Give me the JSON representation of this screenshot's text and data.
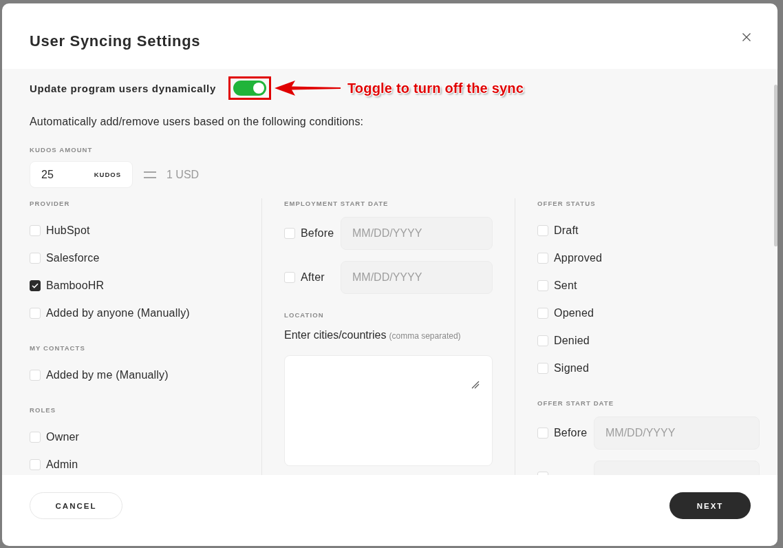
{
  "dialog": {
    "title": "User Syncing Settings"
  },
  "sync_toggle": {
    "label": "Update program users dynamically",
    "on": true
  },
  "annotation": {
    "text": "Toggle to turn off the sync"
  },
  "intro": "Automatically add/remove users based on the following conditions:",
  "kudos_amount": {
    "label": "KUDOS AMOUNT",
    "value": "25",
    "unit": "KUDOS",
    "equals": "1 USD"
  },
  "columns": [
    {
      "sections": [
        {
          "kind": "checklist",
          "label": "PROVIDER",
          "items": [
            {
              "label": "HubSpot",
              "checked": false
            },
            {
              "label": "Salesforce",
              "checked": false
            },
            {
              "label": "BambooHR",
              "checked": true
            },
            {
              "label": "Added by anyone (Manually)",
              "checked": false
            }
          ]
        },
        {
          "kind": "checklist",
          "label": "MY CONTACTS",
          "items": [
            {
              "label": "Added by me (Manually)",
              "checked": false
            }
          ]
        },
        {
          "kind": "checklist",
          "label": "ROLES",
          "items": [
            {
              "label": "Owner",
              "checked": false
            },
            {
              "label": "Admin",
              "checked": false
            }
          ]
        }
      ]
    },
    {
      "sections": [
        {
          "kind": "date_range",
          "label": "EMPLOYMENT START DATE",
          "rows": [
            {
              "label": "Before",
              "checked": false,
              "disabled": true,
              "placeholder": "MM/DD/YYYY"
            },
            {
              "label": "After",
              "checked": false,
              "disabled": true,
              "placeholder": "MM/DD/YYYY"
            }
          ]
        },
        {
          "kind": "text_area",
          "label": "LOCATION",
          "prompt": "Enter cities/countries",
          "hint": "(comma separated)"
        }
      ]
    },
    {
      "sections": [
        {
          "kind": "checklist",
          "label": "OFFER STATUS",
          "items": [
            {
              "label": "Draft",
              "checked": false
            },
            {
              "label": "Approved",
              "checked": false
            },
            {
              "label": "Sent",
              "checked": false
            },
            {
              "label": "Opened",
              "checked": false
            },
            {
              "label": "Denied",
              "checked": false
            },
            {
              "label": "Signed",
              "checked": false
            }
          ]
        },
        {
          "kind": "date_range",
          "label": "OFFER START DATE",
          "rows": [
            {
              "label": "Before",
              "checked": false,
              "disabled": true,
              "placeholder": "MM/DD/YYYY"
            },
            {
              "checked": false,
              "disabled": true
            }
          ]
        }
      ]
    }
  ],
  "buttons": [
    {
      "label": "CANCEL",
      "kind": "secondary"
    },
    {
      "label": "NEXT",
      "kind": "primary"
    }
  ]
}
